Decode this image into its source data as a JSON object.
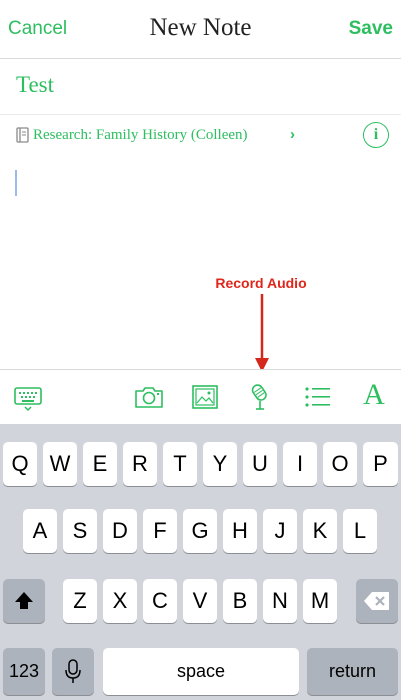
{
  "nav": {
    "cancel_label": "Cancel",
    "title": "New Note",
    "save_label": "Save"
  },
  "note": {
    "title": "Test",
    "notebook": "Research: Family History (Colleen)",
    "info_glyph": "i"
  },
  "annotation": {
    "label": "Record Audio",
    "color": "#e0261b"
  },
  "toolbar": {
    "icons": [
      "keyboard-dismiss-icon",
      "camera-icon",
      "image-icon",
      "microphone-icon",
      "checklist-icon",
      "text-format-icon"
    ],
    "text_format_glyph": "A"
  },
  "keyboard": {
    "row1": [
      "Q",
      "W",
      "E",
      "R",
      "T",
      "Y",
      "U",
      "I",
      "O",
      "P"
    ],
    "row2": [
      "A",
      "S",
      "D",
      "F",
      "G",
      "H",
      "J",
      "K",
      "L"
    ],
    "row3": [
      "Z",
      "X",
      "C",
      "V",
      "B",
      "N",
      "M"
    ],
    "numbers_label": "123",
    "space_label": "space",
    "return_label": "return"
  },
  "colors": {
    "accent": "#2dbe60",
    "keyboard_bg": "#d1d5db",
    "key": "#ffffff",
    "special_key": "#adb3bc"
  }
}
